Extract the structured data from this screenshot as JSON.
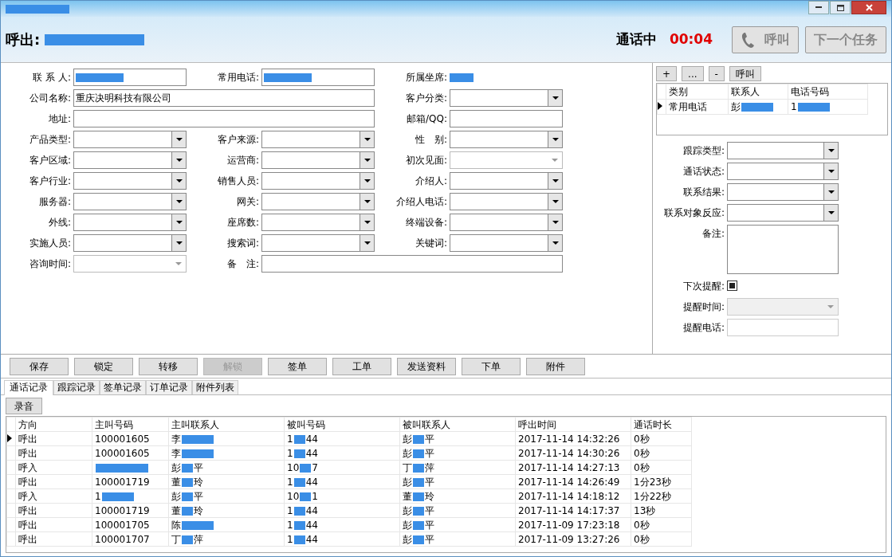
{
  "window": {
    "title_redacted": true
  },
  "header": {
    "direction": "呼出:",
    "number_redacted": true,
    "status": "通话中",
    "timer": "00:04",
    "buttons": [
      {
        "label": "呼叫",
        "kind": "call",
        "disabled": true
      },
      {
        "label": "下一个任务",
        "kind": "plain",
        "disabled": true
      }
    ]
  },
  "form": {
    "rows": [
      [
        {
          "label": "联 系 人:",
          "kind": "text",
          "redacted": true
        },
        {
          "label": "常用电话:",
          "kind": "text",
          "redacted": true
        },
        {
          "label": "所属坐席:",
          "kind": "static",
          "redacted": true
        }
      ],
      [
        {
          "label": "公司名称:",
          "kind": "text",
          "wide": true,
          "value": "重庆决明科技有限公司"
        },
        {
          "label": "客户分类:",
          "kind": "combo"
        }
      ],
      [
        {
          "label": "地址:",
          "kind": "text",
          "wide": true
        },
        {
          "label": "邮箱/QQ:",
          "kind": "text"
        }
      ],
      [
        {
          "label": "产品类型:",
          "kind": "combo"
        },
        {
          "label": "客户来源:",
          "kind": "combo"
        },
        {
          "label": "性　别:",
          "kind": "combo"
        }
      ],
      [
        {
          "label": "客户区域:",
          "kind": "combo"
        },
        {
          "label": "运营商:",
          "kind": "combo"
        },
        {
          "label": "初次见面:",
          "kind": "flat"
        }
      ],
      [
        {
          "label": "客户行业:",
          "kind": "combo"
        },
        {
          "label": "销售人员:",
          "kind": "combo"
        },
        {
          "label": "介绍人:",
          "kind": "combo"
        }
      ],
      [
        {
          "label": "服务器:",
          "kind": "combo"
        },
        {
          "label": "网关:",
          "kind": "combo"
        },
        {
          "label": "介绍人电话:",
          "kind": "combo"
        }
      ],
      [
        {
          "label": "外线:",
          "kind": "combo"
        },
        {
          "label": "座席数:",
          "kind": "combo"
        },
        {
          "label": "终端设备:",
          "kind": "combo"
        }
      ],
      [
        {
          "label": "实施人员:",
          "kind": "combo"
        },
        {
          "label": "搜索词:",
          "kind": "combo"
        },
        {
          "label": "关键词:",
          "kind": "combo"
        }
      ],
      [
        {
          "label": "咨询时间:",
          "kind": "flat"
        },
        {
          "label": "备　注:",
          "kind": "text",
          "wide": true
        }
      ]
    ]
  },
  "phones": {
    "buttons": [
      "+",
      "...",
      "-",
      "呼叫"
    ],
    "columns": [
      "类别",
      "联系人",
      "电话号码"
    ],
    "rows": [
      {
        "current": true,
        "cells": [
          {
            "text": "常用电话"
          },
          {
            "start": "彭",
            "redacted": true
          },
          {
            "start": "1",
            "redacted": true
          }
        ]
      }
    ]
  },
  "tracking": [
    {
      "label": "跟踪类型:",
      "kind": "combo"
    },
    {
      "label": "通话状态:",
      "kind": "combo"
    },
    {
      "label": "联系结果:",
      "kind": "combo"
    },
    {
      "label": "联系对象反应:",
      "kind": "combo"
    },
    {
      "label": "备注:",
      "kind": "memo"
    },
    {
      "label": "下次提醒:",
      "kind": "check",
      "checked": true
    },
    {
      "label": "提醒时间:",
      "kind": "flat",
      "disabled": true
    },
    {
      "label": "提醒电话:",
      "kind": "text",
      "disabled": true
    }
  ],
  "actions": [
    {
      "label": "保存",
      "disabled": false
    },
    {
      "label": "锁定",
      "disabled": false
    },
    {
      "label": "转移",
      "disabled": false
    },
    {
      "label": "解锁",
      "disabled": true
    },
    {
      "label": "签单",
      "disabled": false
    },
    {
      "label": "工单",
      "disabled": false
    },
    {
      "label": "发送资料",
      "disabled": false
    },
    {
      "label": "下单",
      "disabled": false
    },
    {
      "label": "附件",
      "disabled": false
    }
  ],
  "tabs": [
    {
      "label": "通话记录",
      "selected": true
    },
    {
      "label": "跟踪记录",
      "selected": false
    },
    {
      "label": "签单记录",
      "selected": false
    },
    {
      "label": "订单记录",
      "selected": false
    },
    {
      "label": "附件列表",
      "selected": false
    }
  ],
  "record_button": "录音",
  "calls": {
    "columns": [
      "方向",
      "主叫号码",
      "主叫联系人",
      "被叫号码",
      "被叫联系人",
      "呼出时间",
      "通话时长"
    ],
    "rows": [
      {
        "current": true,
        "cells": [
          {
            "text": "呼出"
          },
          {
            "text": "100001605"
          },
          {
            "start": "李",
            "redacted": true
          },
          {
            "start": "1",
            "end": "44",
            "redacted": true
          },
          {
            "start": "彭",
            "end": "平",
            "redacted": true
          },
          {
            "text": "2017-11-14 14:32:26"
          },
          {
            "text": "0秒"
          }
        ]
      },
      {
        "current": false,
        "cells": [
          {
            "text": "呼出"
          },
          {
            "text": "100001605"
          },
          {
            "start": "李",
            "redacted": true
          },
          {
            "start": "1",
            "end": "44",
            "redacted": true
          },
          {
            "start": "彭",
            "end": "平",
            "redacted": true
          },
          {
            "text": "2017-11-14 14:30:26"
          },
          {
            "text": "0秒"
          }
        ]
      },
      {
        "current": false,
        "cells": [
          {
            "text": "呼入"
          },
          {
            "redacted": true
          },
          {
            "start": "彭",
            "end": "平",
            "redacted": true
          },
          {
            "start": "10",
            "end": "7",
            "redacted": true
          },
          {
            "start": "丁",
            "end": "萍",
            "redacted": true
          },
          {
            "text": "2017-11-14 14:27:13"
          },
          {
            "text": "0秒"
          }
        ]
      },
      {
        "current": false,
        "cells": [
          {
            "text": "呼出"
          },
          {
            "text": "100001719"
          },
          {
            "start": "董",
            "end": "玲",
            "redacted": true
          },
          {
            "start": "1",
            "end": "44",
            "redacted": true
          },
          {
            "start": "彭",
            "end": "平",
            "redacted": true
          },
          {
            "text": "2017-11-14 14:26:49"
          },
          {
            "text": "1分23秒"
          }
        ]
      },
      {
        "current": false,
        "cells": [
          {
            "text": "呼入"
          },
          {
            "start": "1",
            "redacted": true
          },
          {
            "start": "彭",
            "end": "平",
            "redacted": true
          },
          {
            "start": "10",
            "end": "1",
            "redacted": true
          },
          {
            "start": "董",
            "end": "玲",
            "redacted": true
          },
          {
            "text": "2017-11-14 14:18:12"
          },
          {
            "text": "1分22秒"
          }
        ]
      },
      {
        "current": false,
        "cells": [
          {
            "text": "呼出"
          },
          {
            "text": "100001719"
          },
          {
            "start": "董",
            "end": "玲",
            "redacted": true
          },
          {
            "start": "1",
            "end": "44",
            "redacted": true
          },
          {
            "start": "彭",
            "end": "平",
            "redacted": true
          },
          {
            "text": "2017-11-14 14:17:37"
          },
          {
            "text": "13秒"
          }
        ]
      },
      {
        "current": false,
        "cells": [
          {
            "text": "呼出"
          },
          {
            "text": "100001705"
          },
          {
            "start": "陈",
            "redacted": true
          },
          {
            "start": "1",
            "end": "44",
            "redacted": true
          },
          {
            "start": "彭",
            "end": "平",
            "redacted": true
          },
          {
            "text": "2017-11-09 17:23:18"
          },
          {
            "text": "0秒"
          }
        ]
      },
      {
        "current": false,
        "cells": [
          {
            "text": "呼出"
          },
          {
            "text": "100001707"
          },
          {
            "start": "丁",
            "end": "萍",
            "redacted": true
          },
          {
            "start": "1",
            "end": "44",
            "redacted": true
          },
          {
            "start": "彭",
            "end": "平",
            "redacted": true
          },
          {
            "text": "2017-11-09 13:27:26"
          },
          {
            "text": "0秒"
          }
        ]
      }
    ]
  }
}
